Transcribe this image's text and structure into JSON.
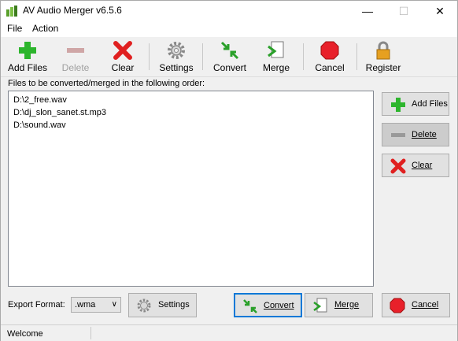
{
  "window": {
    "title": "AV Audio Merger v6.5.6"
  },
  "menu": [
    "File",
    "Action"
  ],
  "toolbar": {
    "add_files": "Add Files",
    "delete": "Delete",
    "clear": "Clear",
    "settings": "Settings",
    "convert": "Convert",
    "merge": "Merge",
    "cancel": "Cancel",
    "register": "Register"
  },
  "list": {
    "caption": "Files to be converted/merged in the following order:",
    "files": [
      "D:\\2_free.wav",
      "D:\\dj_slon_sanet.st.mp3",
      "D:\\sound.wav"
    ]
  },
  "side": {
    "add_files": "Add Files",
    "delete": "Delete",
    "clear": "Clear"
  },
  "bottom": {
    "export_label": "Export Format:",
    "export_value": ".wma",
    "settings": "Settings",
    "convert": "Convert",
    "merge": "Merge",
    "cancel": "Cancel"
  },
  "status": {
    "text": "Welcome"
  },
  "colors": {
    "accent": "#0078d7",
    "green": "#2db52d",
    "red": "#e02020",
    "stop_red": "#e8202a"
  }
}
